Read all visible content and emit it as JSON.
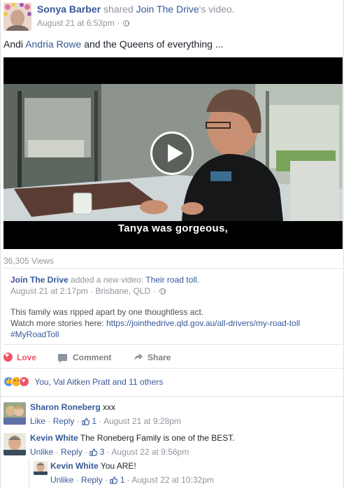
{
  "post": {
    "author": "Sonya Barber",
    "shared_text": "shared",
    "shared_page": "Join The Drive",
    "shared_suffix": "'s video.",
    "timestamp": "August 21 at 6:53pm",
    "dot": "·",
    "text_prefix": "Andi",
    "tag": "Andria Rowe",
    "text_suffix": "and the Queens of everything ..."
  },
  "video": {
    "caption": "Tanya was gorgeous,",
    "views": "36,305 Views"
  },
  "shared": {
    "page": "Join The Drive",
    "added_text": "added a new video:",
    "video_title": "Their road toll.",
    "timestamp": "August 21 at 2:17pm",
    "location": "Brisbane, QLD",
    "line1": "This family was ripped apart by one thoughtless act.",
    "line2_prefix": "Watch more stories here:",
    "url": "https://jointhedrive.qld.gov.au/all-drivers/my-road-toll",
    "hashtag": "#MyRoadToll"
  },
  "actions": {
    "love": "Love",
    "comment": "Comment",
    "share": "Share"
  },
  "reactions": {
    "summary": "You, Val Aitken Pratt and 11 others"
  },
  "comments": [
    {
      "name": "Sharon Roneberg",
      "text": "xxx",
      "action1": "Like",
      "action2": "Reply",
      "likes": "1",
      "time": "August 21 at 9:28pm"
    },
    {
      "name": "Kevin White",
      "text": "The Roneberg Family is one of the BEST.",
      "action1": "Unlike",
      "action2": "Reply",
      "likes": "3",
      "time": "August 22 at 9:56pm"
    },
    {
      "name": "Kevin White",
      "text": "You ARE!",
      "action1": "Unlike",
      "action2": "Reply",
      "likes": "1",
      "time": "August 22 at 10:32pm"
    }
  ],
  "colors": {
    "link": "#365899",
    "muted": "#90949c",
    "love": "#f25268",
    "like": "#5890ff"
  }
}
